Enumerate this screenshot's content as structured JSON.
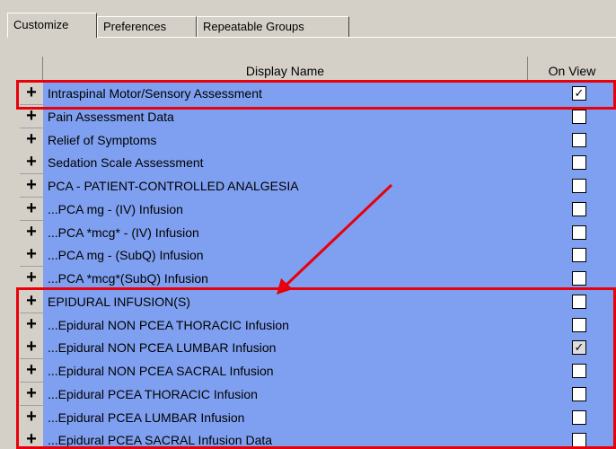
{
  "tabs": [
    {
      "label": "Customize",
      "active": true
    },
    {
      "label": "Preferences",
      "active": false
    },
    {
      "label": "Repeatable Groups",
      "active": false
    }
  ],
  "grid": {
    "columns": {
      "display_name": "Display Name",
      "on_view": "On View"
    },
    "expand_glyph": "+",
    "rows": [
      {
        "name": "Intraspinal Motor/Sensory Assessment",
        "on_view": true
      },
      {
        "name": "Pain Assessment Data",
        "on_view": false
      },
      {
        "name": "Relief of Symptoms",
        "on_view": false
      },
      {
        "name": "Sedation Scale Assessment",
        "on_view": false
      },
      {
        "name": "PCA - PATIENT-CONTROLLED ANALGESIA",
        "on_view": false
      },
      {
        "name": "...PCA mg - (IV) Infusion",
        "on_view": false
      },
      {
        "name": "...PCA *mcg* - (IV) Infusion",
        "on_view": false
      },
      {
        "name": "...PCA mg - (SubQ) Infusion",
        "on_view": false
      },
      {
        "name": "...PCA *mcg*(SubQ) Infusion",
        "on_view": false
      },
      {
        "name": "EPIDURAL INFUSION(S)",
        "on_view": false
      },
      {
        "name": "...Epidural NON PCEA THORACIC Infusion",
        "on_view": false
      },
      {
        "name": "...Epidural NON PCEA LUMBAR Infusion",
        "on_view": true
      },
      {
        "name": "...Epidural NON PCEA SACRAL Infusion",
        "on_view": false
      },
      {
        "name": "...Epidural PCEA THORACIC Infusion",
        "on_view": false
      },
      {
        "name": "...Epidural PCEA LUMBAR Infusion",
        "on_view": false
      },
      {
        "name": "...Epidural PCEA SACRAL Infusion Data",
        "on_view": false
      }
    ]
  },
  "colors": {
    "grid_bg": "#7fa0f0",
    "highlight": "#e8000b",
    "panel": "#d4d0c8"
  },
  "check_glyph": "✓"
}
